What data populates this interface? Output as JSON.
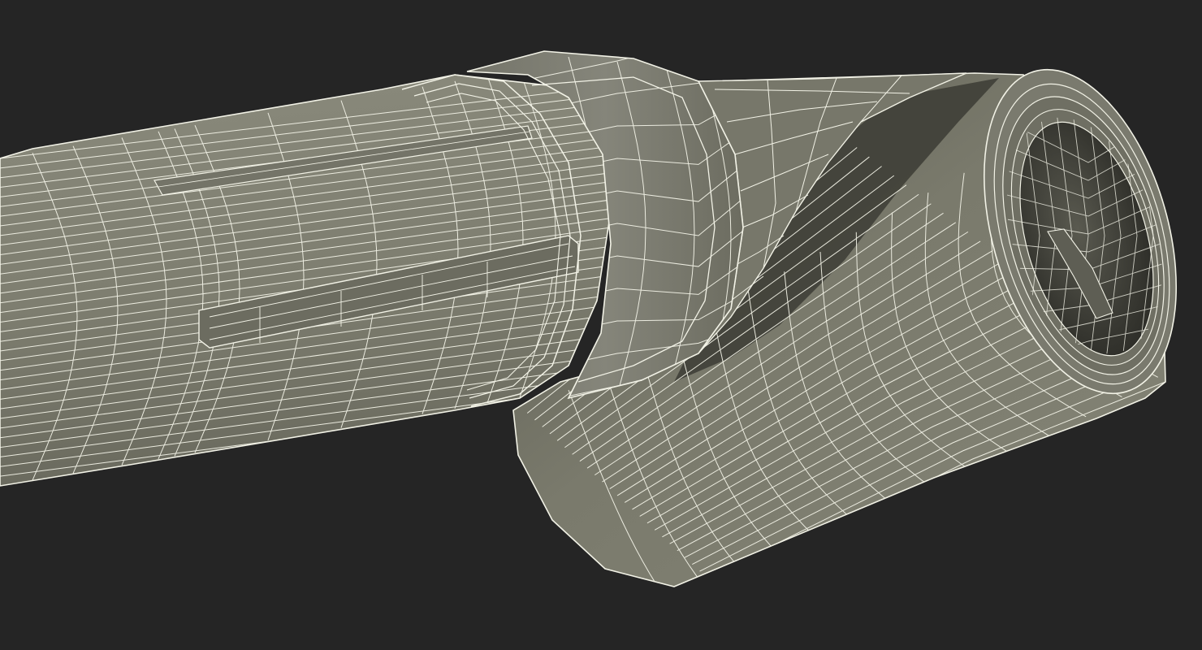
{
  "scene": {
    "subject": "wireframe-render-rolled-tube",
    "colors": {
      "background": "#252525",
      "surface_light": "#7f7f70",
      "surface_mid": "#6e6e62",
      "surface_dark": "#4a4a42",
      "shadow": "#2f2f2b",
      "wire": "#f2f2e6"
    }
  }
}
